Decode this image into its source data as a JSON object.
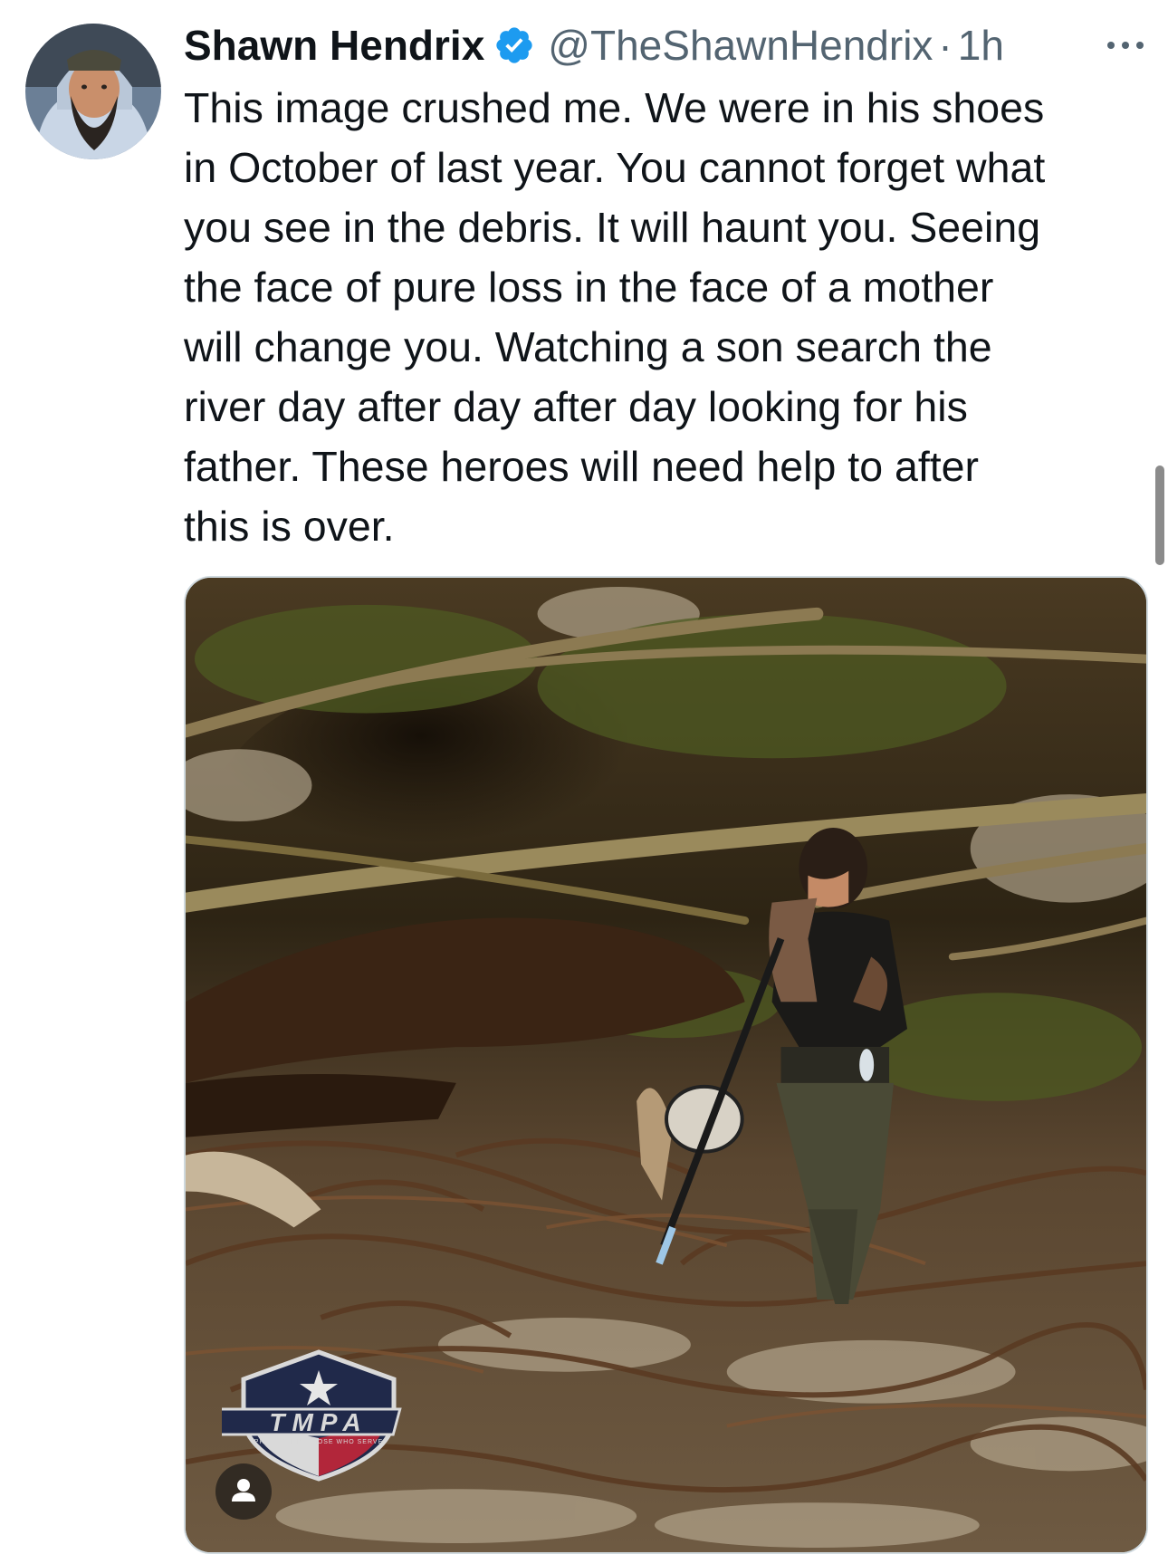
{
  "tweet": {
    "author": {
      "display_name": "Shawn Hendrix",
      "handle": "@TheShawnHendrix",
      "verified": true,
      "avatar_icon": "avatar-photo"
    },
    "separator": "·",
    "time": "1h",
    "more_icon": "more-horizontal-icon",
    "text": "This image crushed me. We were in his shoes\nin October of last year. You cannot forget what\nyou see in the debris. It will haunt you. Seeing\nthe face of pure loss in the face of a mother\nwill change you. Watching a son search the\nriver day after day after day looking for his\nfather. These heroes will need help to after\nthis is over.",
    "media": {
      "type": "photo",
      "logo_text": "TMPA",
      "logo_tagline": "PROTECTING THOSE WHO SERVE",
      "alt_icon": "person-icon"
    }
  },
  "colors": {
    "text_primary": "#0f1419",
    "text_secondary": "#536471",
    "verified_blue": "#1d9bf0"
  }
}
